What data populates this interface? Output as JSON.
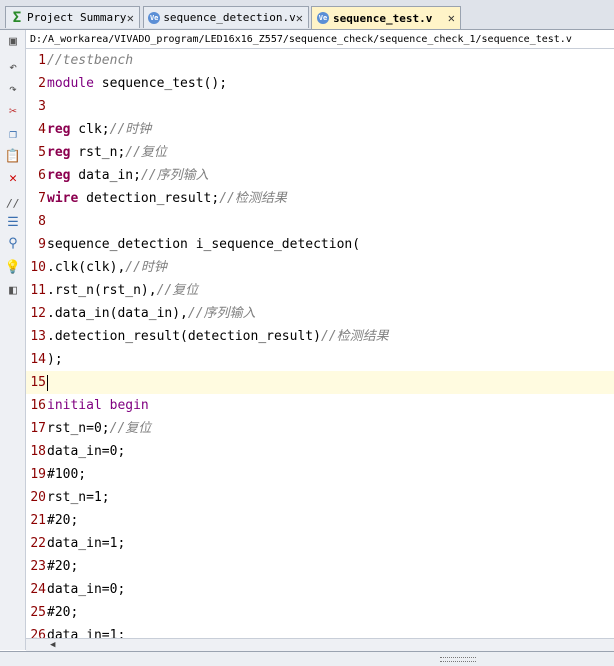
{
  "tabs": [
    {
      "label": "Project Summary",
      "icon": "sigma-icon",
      "active": false
    },
    {
      "label": "sequence_detection.v",
      "icon": "verilog-file-icon",
      "active": false
    },
    {
      "label": "sequence_test.v",
      "icon": "verilog-file-icon",
      "active": true
    }
  ],
  "close_glyph": "✕",
  "file_path": "D:/A_workarea/VIVADO_program/LED16x16_Z557/sequence_check/sequence_check_1/sequence_test.v",
  "lines": [
    {
      "n": "1",
      "tokens": [
        {
          "t": "//testbench",
          "c": "cm"
        }
      ]
    },
    {
      "n": "2",
      "tokens": [
        {
          "t": "module",
          "c": "kwp"
        },
        {
          "t": " sequence_test();",
          "c": ""
        }
      ]
    },
    {
      "n": "3",
      "tokens": []
    },
    {
      "n": "4",
      "tokens": [
        {
          "t": "reg",
          "c": "kw"
        },
        {
          "t": " clk;",
          "c": ""
        },
        {
          "t": "//时钟",
          "c": "cm"
        }
      ]
    },
    {
      "n": "5",
      "tokens": [
        {
          "t": "reg",
          "c": "kw"
        },
        {
          "t": " rst_n;",
          "c": ""
        },
        {
          "t": "//复位",
          "c": "cm"
        }
      ]
    },
    {
      "n": "6",
      "tokens": [
        {
          "t": "reg",
          "c": "kw"
        },
        {
          "t": " data_in;",
          "c": ""
        },
        {
          "t": "//序列输入",
          "c": "cm"
        }
      ]
    },
    {
      "n": "7",
      "tokens": [
        {
          "t": "wire",
          "c": "kw"
        },
        {
          "t": " detection_result;",
          "c": ""
        },
        {
          "t": "//检测结果",
          "c": "cm"
        }
      ]
    },
    {
      "n": "8",
      "tokens": []
    },
    {
      "n": "9",
      "tokens": [
        {
          "t": "sequence_detection i_sequence_detection(",
          "c": ""
        }
      ]
    },
    {
      "n": "10",
      "tokens": [
        {
          "t": ".clk(clk),",
          "c": ""
        },
        {
          "t": "//时钟",
          "c": "cm"
        }
      ]
    },
    {
      "n": "11",
      "tokens": [
        {
          "t": ".rst_n(rst_n),",
          "c": ""
        },
        {
          "t": "//复位",
          "c": "cm"
        }
      ]
    },
    {
      "n": "12",
      "tokens": [
        {
          "t": ".data_in(data_in),",
          "c": ""
        },
        {
          "t": "//序列输入",
          "c": "cm"
        }
      ]
    },
    {
      "n": "13",
      "tokens": [
        {
          "t": ".detection_result(detection_result)",
          "c": ""
        },
        {
          "t": "//检测结果",
          "c": "cm"
        }
      ]
    },
    {
      "n": "14",
      "tokens": [
        {
          "t": ");",
          "c": ""
        }
      ]
    },
    {
      "n": "15",
      "tokens": [],
      "current": true
    },
    {
      "n": "16",
      "tokens": [
        {
          "t": "initial begin",
          "c": "kwp"
        }
      ]
    },
    {
      "n": "17",
      "tokens": [
        {
          "t": "rst_n=0;",
          "c": ""
        },
        {
          "t": "//复位",
          "c": "cm"
        }
      ]
    },
    {
      "n": "18",
      "tokens": [
        {
          "t": "data_in=0;",
          "c": ""
        }
      ]
    },
    {
      "n": "19",
      "tokens": [
        {
          "t": "#100;",
          "c": ""
        }
      ]
    },
    {
      "n": "20",
      "tokens": [
        {
          "t": "rst_n=1;",
          "c": ""
        }
      ]
    },
    {
      "n": "21",
      "tokens": [
        {
          "t": "#20;",
          "c": ""
        }
      ]
    },
    {
      "n": "22",
      "tokens": [
        {
          "t": "data_in=1;",
          "c": ""
        }
      ]
    },
    {
      "n": "23",
      "tokens": [
        {
          "t": "#20;",
          "c": ""
        }
      ]
    },
    {
      "n": "24",
      "tokens": [
        {
          "t": "data_in=0;",
          "c": ""
        }
      ]
    },
    {
      "n": "25",
      "tokens": [
        {
          "t": "#20;",
          "c": ""
        }
      ]
    },
    {
      "n": "26",
      "tokens": [
        {
          "t": "data_in=1;",
          "c": ""
        }
      ]
    }
  ],
  "toolbar_icons": [
    "save-icon",
    "undo-icon",
    "redo-icon",
    "cut-icon",
    "copy-icon",
    "paste-icon",
    "delete-icon",
    "comment-icon",
    "align-icon",
    "find-icon",
    "hint-icon",
    "template-icon"
  ],
  "colors": {
    "line_number": "#8b0000",
    "keyword": "#8b004f",
    "comment": "#808080",
    "current_line": "#fffbe0"
  }
}
